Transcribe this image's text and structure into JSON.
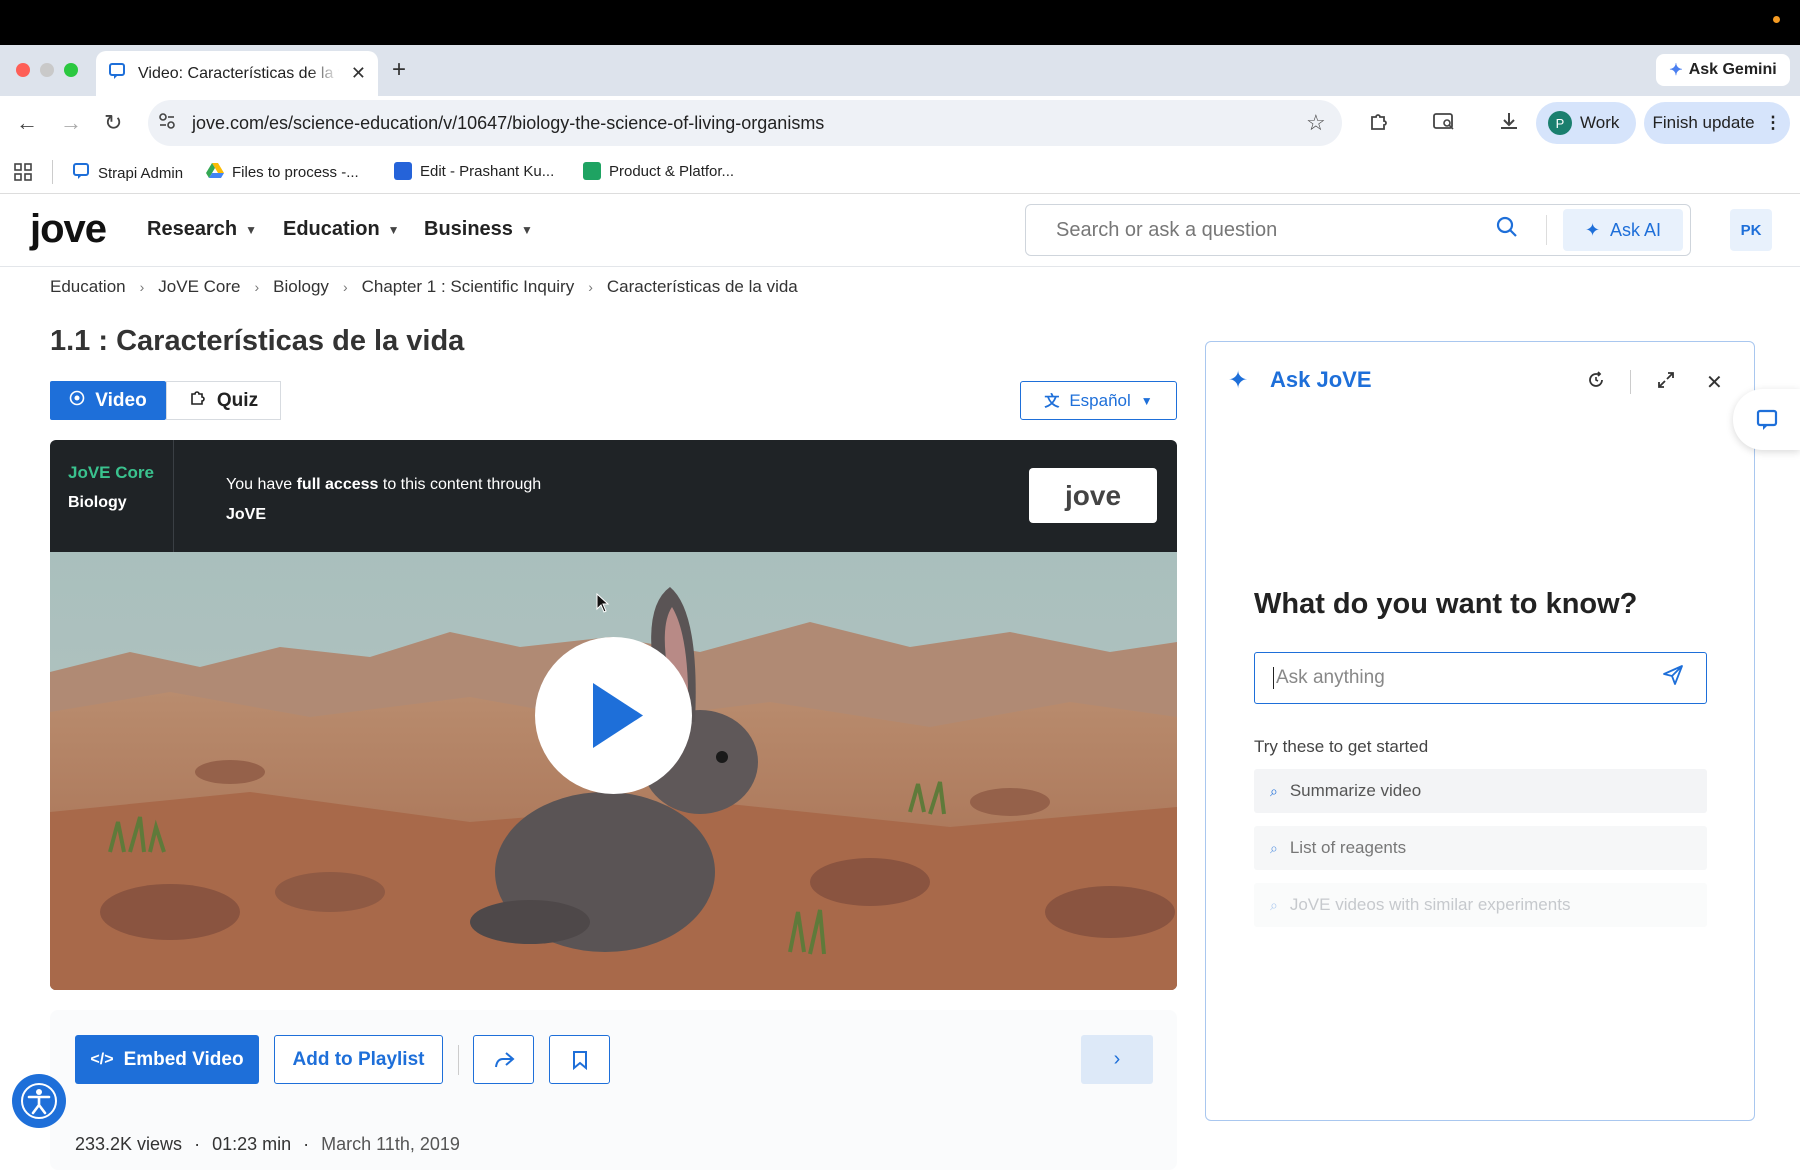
{
  "browser": {
    "tab_title": "Video: Características de la vida",
    "new_tab": "+",
    "ask_gemini": "Ask Gemini",
    "url": "jove.com/es/science-education/v/10647/biology-the-science-of-living-organisms",
    "profile_letter": "P",
    "profile_label": "Work",
    "finish_update": "Finish update",
    "bookmarks": [
      "Strapi Admin",
      "Files to process -...",
      "Edit - Prashant Ku...",
      "Product & Platfor..."
    ]
  },
  "site": {
    "logo": "jove",
    "menu": [
      "Research",
      "Education",
      "Business"
    ],
    "search_placeholder": "Search or ask a question",
    "ask_ai": "Ask AI",
    "user_initials": "PK"
  },
  "breadcrumb": [
    "Education",
    "JoVE Core",
    "Biology",
    "Chapter 1 : Scientific Inquiry",
    "Características de la vida"
  ],
  "page": {
    "title": "1.1 : Características de la vida",
    "tab_video": "Video",
    "tab_quiz": "Quiz",
    "language": "Español"
  },
  "video": {
    "collection": "JoVE Core",
    "subject": "Biology",
    "access_prefix": "You have ",
    "access_bold": "full access",
    "access_suffix": " to this content through",
    "access_provider": "JoVE",
    "logo": "jove"
  },
  "actions": {
    "embed": "Embed Video",
    "playlist": "Add to Playlist",
    "views": "233.2K views",
    "duration": "01:23 min",
    "date": "March 11th, 2019",
    "dot": "·"
  },
  "ask_panel": {
    "title": "Ask JoVE",
    "question": "What do you want to know?",
    "placeholder": "Ask anything",
    "try_label": "Try these to get started",
    "suggestions": [
      "Summarize video",
      "List of reagents",
      "JoVE videos with similar experiments"
    ]
  },
  "colors": {
    "accent": "#1e6fd9",
    "core_green": "#3ac28e",
    "dark_header": "#1f2326"
  }
}
